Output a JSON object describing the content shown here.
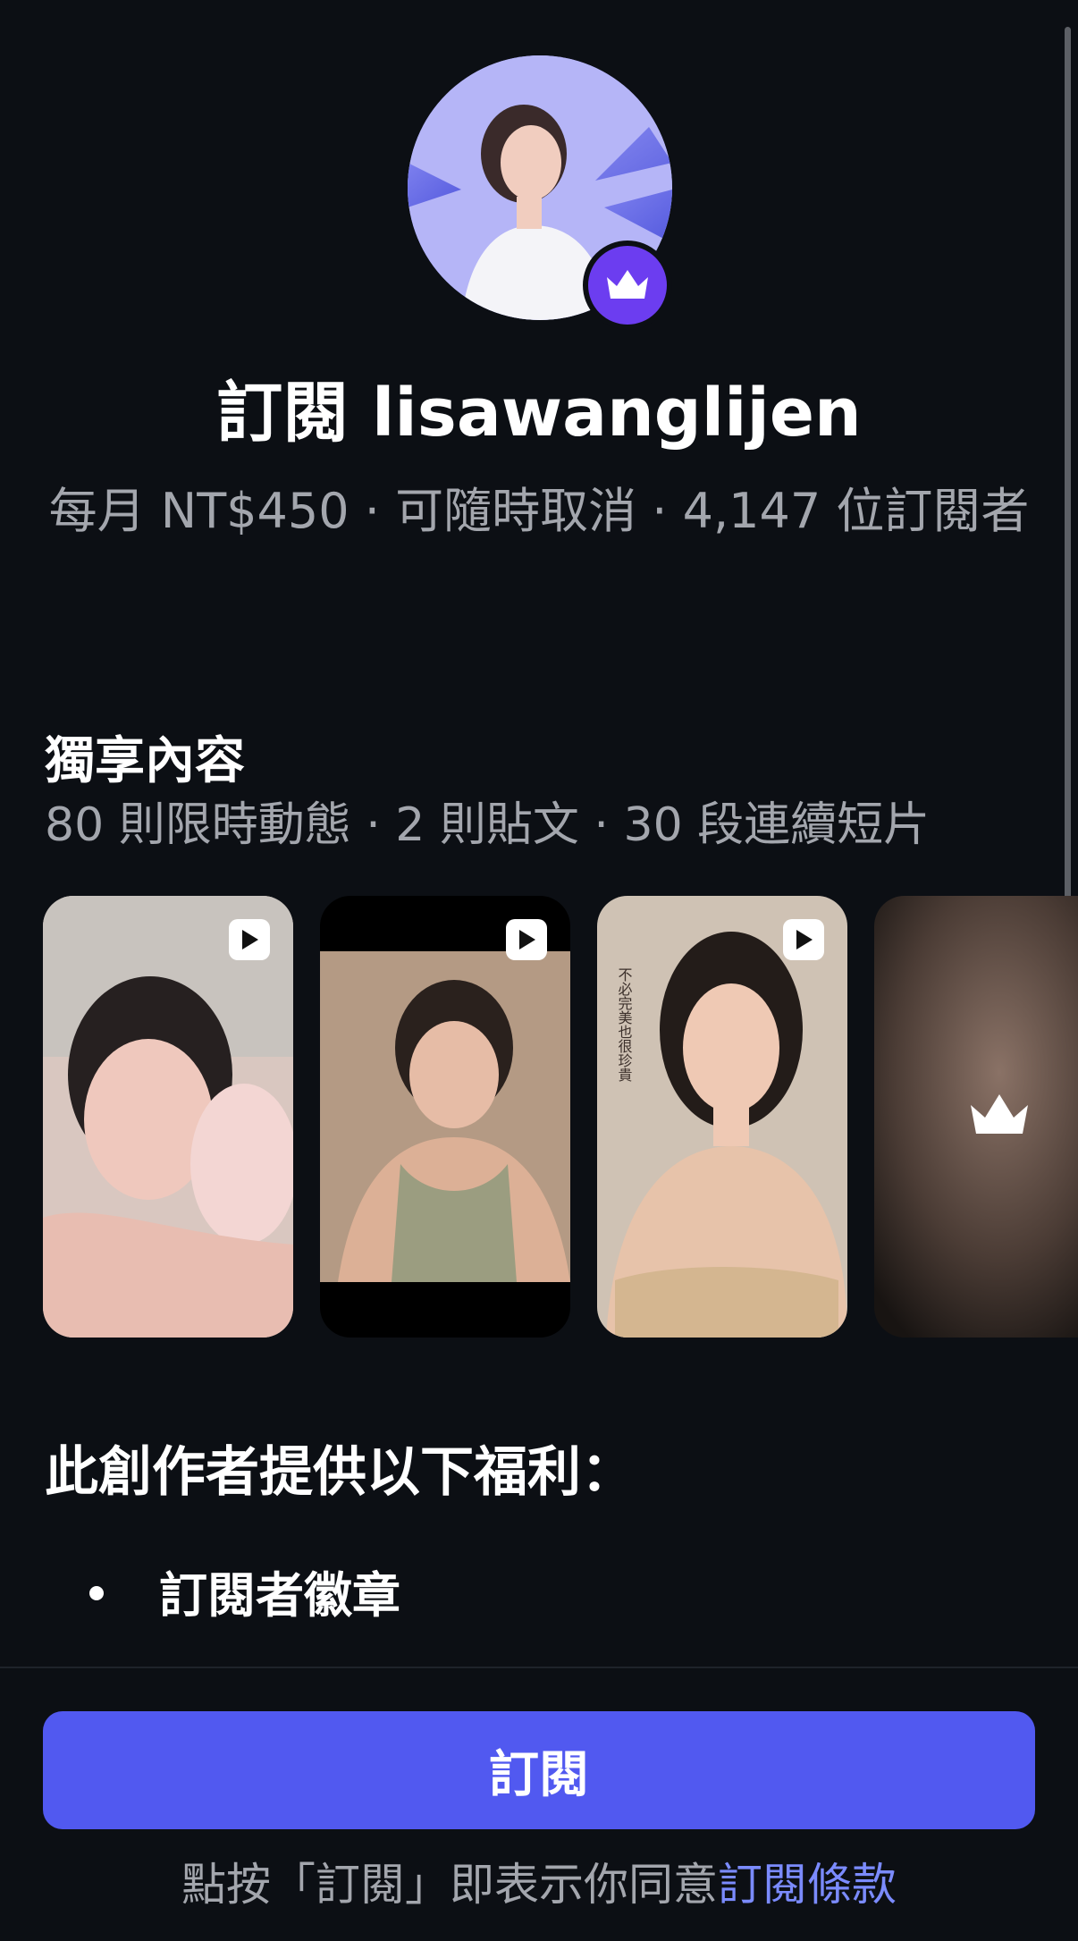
{
  "profile": {
    "title": "訂閱 lisawanglijen",
    "meta": "每月 NT$450 · 可隨時取消 · 4,147 位訂閱者"
  },
  "exclusive": {
    "title": "獨享內容",
    "summary": "80 則限時動態 · 2 則貼文 · 30 段連續短片"
  },
  "thumbnails": [
    {
      "type": "video",
      "icon": "play-icon"
    },
    {
      "type": "video",
      "icon": "play-icon"
    },
    {
      "type": "video",
      "icon": "play-icon",
      "caption": "不必完美也很珍貴"
    },
    {
      "type": "locked",
      "icon": "crown-icon"
    }
  ],
  "benefits": {
    "title": "此創作者提供以下福利：",
    "items": [
      "訂閱者徽章"
    ]
  },
  "footer": {
    "subscribe_label": "訂閱",
    "terms_prefix": "點按「訂閱」即表示你同意",
    "terms_link": "訂閱條款"
  },
  "colors": {
    "background": "#0c0f14",
    "accent": "#5159f0",
    "badge": "#6c3df0",
    "link": "#7b8bff",
    "muted_text": "#a3a6ad"
  }
}
